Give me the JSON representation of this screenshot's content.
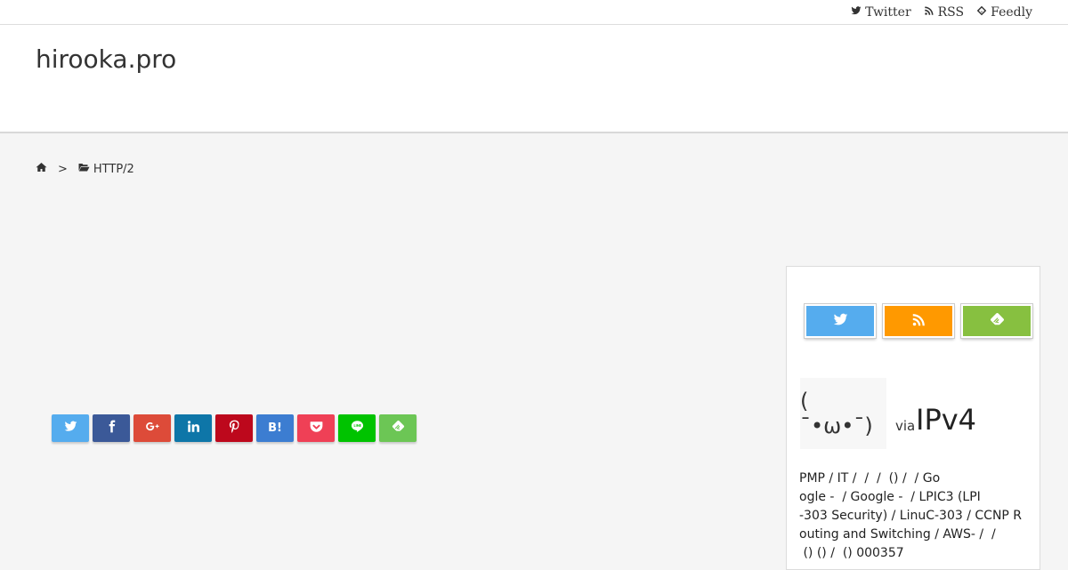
{
  "topbar": {
    "links": [
      {
        "label": "Twitter",
        "icon": "twitter-icon"
      },
      {
        "label": "RSS",
        "icon": "rss-icon"
      },
      {
        "label": "Feedly",
        "icon": "feedly-icon"
      }
    ]
  },
  "header": {
    "site_title": "hirooka.pro"
  },
  "breadcrumb": {
    "separator": ">",
    "category": "HTTP/2",
    "home_icon": "home-icon",
    "folder_icon": "folder-open-icon"
  },
  "share_buttons": [
    {
      "name": "twitter",
      "icon": "twitter-icon",
      "color": "#55acee"
    },
    {
      "name": "facebook",
      "icon": "facebook-icon",
      "color": "#3b5998"
    },
    {
      "name": "google-plus",
      "icon": "google-plus-icon",
      "color": "#dd4b39"
    },
    {
      "name": "linkedin",
      "icon": "linkedin-icon",
      "color": "#0e76a8"
    },
    {
      "name": "pinterest",
      "icon": "pinterest-icon",
      "color": "#bd081c"
    },
    {
      "name": "hatena",
      "icon": "hatena-bookmark-icon",
      "color": "#3c7dd1",
      "label": "B!"
    },
    {
      "name": "pocket",
      "icon": "pocket-icon",
      "color": "#ef4056"
    },
    {
      "name": "line",
      "icon": "line-icon",
      "color": "#00c300"
    },
    {
      "name": "feedly",
      "icon": "feedly-icon",
      "color": "#6cc655"
    }
  ],
  "sidebar": {
    "follow_buttons": [
      {
        "name": "twitter",
        "icon": "twitter-icon",
        "color": "#55acee"
      },
      {
        "name": "rss",
        "icon": "rss-icon",
        "color": "#ff9900"
      },
      {
        "name": "feedly",
        "icon": "feedly-icon",
        "color": "#87c040"
      }
    ],
    "avatar_text": "( ˉ•ω•ˉ)",
    "via": "via",
    "handle": "IPv4",
    "bio_lines": [
      "PMP / IT /  /  /  () /  / Go",
      "ogle -  / Google -  / LPIC3 (LPI",
      "-303 Security) / LinuC-303 / CCNP R",
      "outing and Switching / AWS- /  /",
      " () () /  () 000357"
    ]
  }
}
